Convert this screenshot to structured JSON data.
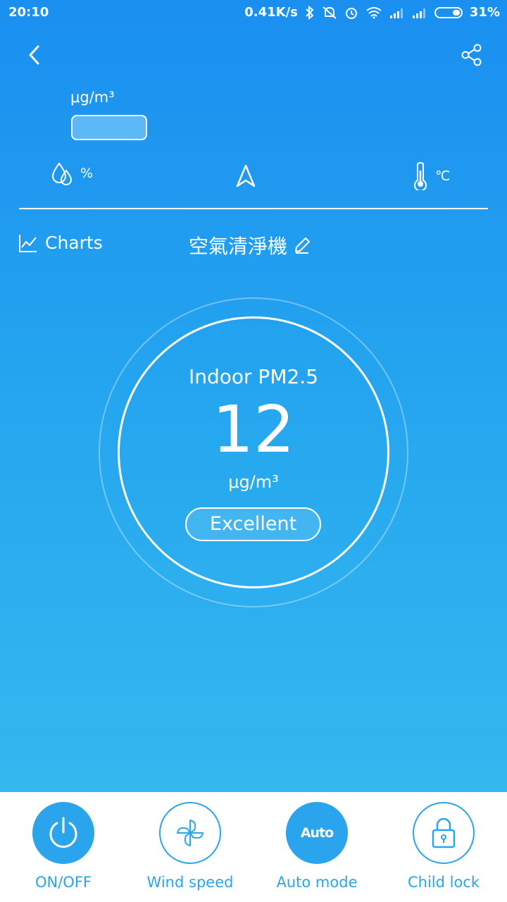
{
  "status_bar": {
    "time": "20:10",
    "net_speed": "0.41K/s",
    "battery": "31%"
  },
  "outdoor": {
    "unit": "μg/m³"
  },
  "environment": {
    "humidity_unit": "%",
    "temperature_unit": "℃"
  },
  "charts_label": "Charts",
  "device_name": "空氣清淨機",
  "gauge": {
    "label": "Indoor PM2.5",
    "value": "12",
    "unit": "μg/m³",
    "quality": "Excellent"
  },
  "controls": [
    {
      "label": "ON/OFF",
      "icon": "power-icon"
    },
    {
      "label": "Wind speed",
      "icon": "fan-icon"
    },
    {
      "label": "Auto mode",
      "icon": "auto-icon",
      "icon_text": "Auto"
    },
    {
      "label": "Child lock",
      "icon": "lock-icon"
    }
  ],
  "colors": {
    "accent": "#2aa4ec",
    "background_top": "#1a8ff0",
    "background_bottom": "#39bdef"
  }
}
